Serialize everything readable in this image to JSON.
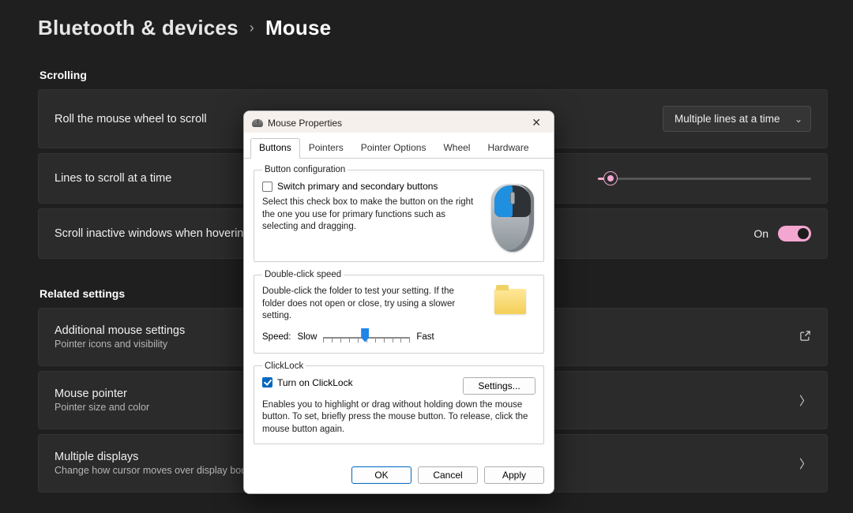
{
  "breadcrumb": {
    "parent": "Bluetooth & devices",
    "separator": "›",
    "current": "Mouse"
  },
  "sections": {
    "scrolling": "Scrolling",
    "related": "Related settings"
  },
  "cards": {
    "roll": {
      "title": "Roll the mouse wheel to scroll",
      "dropdown_value": "Multiple lines at a time"
    },
    "lines": {
      "title": "Lines to scroll at a time"
    },
    "inactive": {
      "title": "Scroll inactive windows when hovering over them",
      "state_label": "On"
    },
    "additional": {
      "title": "Additional mouse settings",
      "subtitle": "Pointer icons and visibility"
    },
    "pointer": {
      "title": "Mouse pointer",
      "subtitle": "Pointer size and color"
    },
    "displays": {
      "title": "Multiple displays",
      "subtitle": "Change how cursor moves over display boundaries"
    }
  },
  "dialog": {
    "title": "Mouse Properties",
    "tabs": {
      "buttons": "Buttons",
      "pointers": "Pointers",
      "pointer_options": "Pointer Options",
      "wheel": "Wheel",
      "hardware": "Hardware"
    },
    "button_config": {
      "legend": "Button configuration",
      "checkbox_label": "Switch primary and secondary buttons",
      "desc": "Select this check box to make the button on the right the one you use for primary functions such as selecting and dragging."
    },
    "double_click": {
      "legend": "Double-click speed",
      "desc": "Double-click the folder to test your setting. If the folder does not open or close, try using a slower setting.",
      "speed_label": "Speed:",
      "slow": "Slow",
      "fast": "Fast"
    },
    "clicklock": {
      "legend": "ClickLock",
      "checkbox_label": "Turn on ClickLock",
      "settings_btn": "Settings...",
      "desc": "Enables you to highlight or drag without holding down the mouse button. To set, briefly press the mouse button. To release, click the mouse button again."
    },
    "buttons_row": {
      "ok": "OK",
      "cancel": "Cancel",
      "apply": "Apply"
    }
  }
}
